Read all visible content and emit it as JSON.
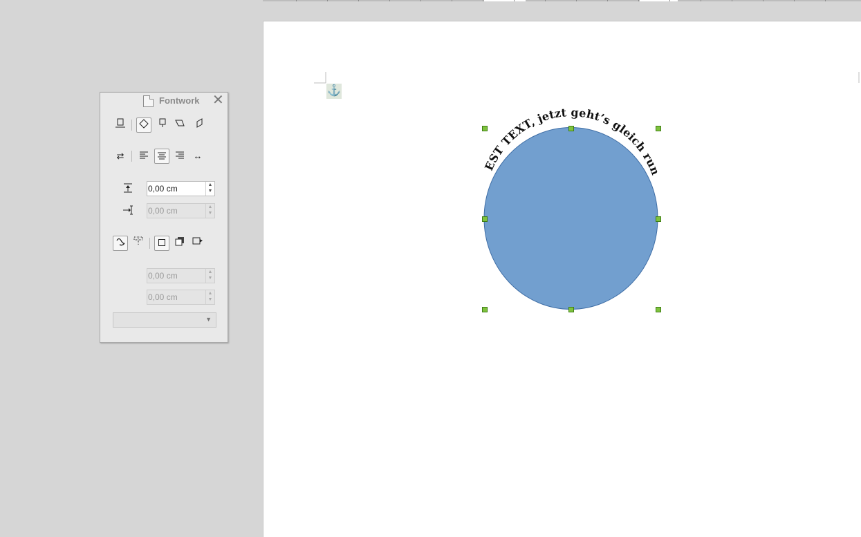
{
  "panel": {
    "title": "Fontwork",
    "distance_value": "0,00 cm",
    "indent_value": "0,00 cm",
    "shadow_x_value": "0,00 cm",
    "shadow_y_value": "0,00 cm",
    "shadow_color_value": ""
  },
  "shape": {
    "fontwork_text": "TEST TEXT, jetzt geht’s gleich rund",
    "fill_color": "#729fcf",
    "handle_color": "#7ec23d"
  },
  "icons": {
    "anchor": "anchor-icon"
  }
}
